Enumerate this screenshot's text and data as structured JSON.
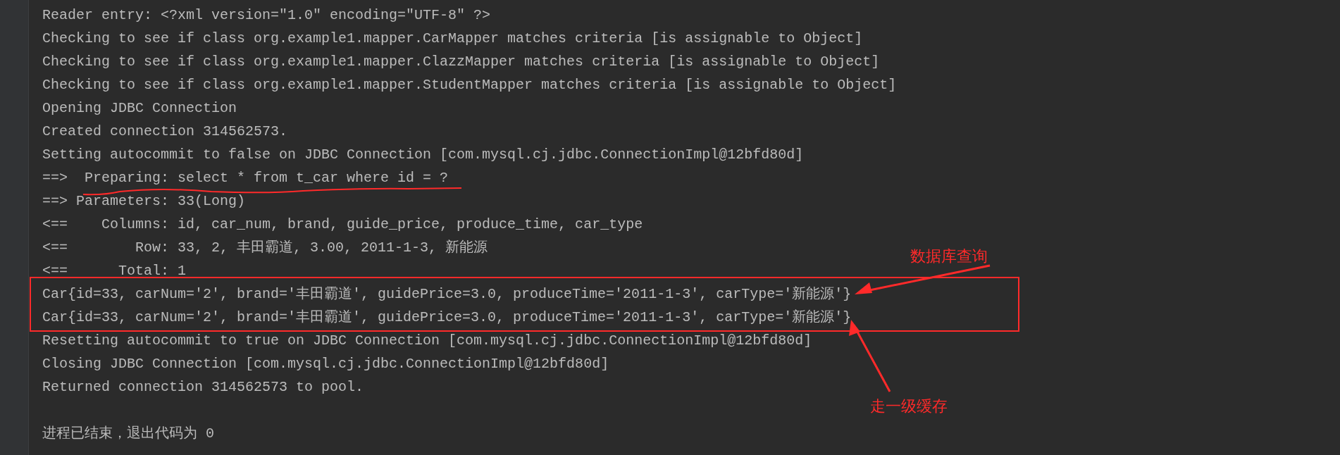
{
  "console": {
    "lines": [
      "Reader entry: <?xml version=\"1.0\" encoding=\"UTF-8\" ?>",
      "Checking to see if class org.example1.mapper.CarMapper matches criteria [is assignable to Object]",
      "Checking to see if class org.example1.mapper.ClazzMapper matches criteria [is assignable to Object]",
      "Checking to see if class org.example1.mapper.StudentMapper matches criteria [is assignable to Object]",
      "Opening JDBC Connection",
      "Created connection 314562573.",
      "Setting autocommit to false on JDBC Connection [com.mysql.cj.jdbc.ConnectionImpl@12bfd80d]",
      "==>  Preparing: select * from t_car where id = ?",
      "==> Parameters: 33(Long)",
      "<==    Columns: id, car_num, brand, guide_price, produce_time, car_type",
      "<==        Row: 33, 2, 丰田霸道, 3.00, 2011-1-3, 新能源",
      "<==      Total: 1",
      "Car{id=33, carNum='2', brand='丰田霸道', guidePrice=3.0, produceTime='2011-1-3', carType='新能源'}",
      "Car{id=33, carNum='2', brand='丰田霸道', guidePrice=3.0, produceTime='2011-1-3', carType='新能源'}",
      "Resetting autocommit to true on JDBC Connection [com.mysql.cj.jdbc.ConnectionImpl@12bfd80d]",
      "Closing JDBC Connection [com.mysql.cj.jdbc.ConnectionImpl@12bfd80d]",
      "Returned connection 314562573 to pool."
    ],
    "exit_message": "进程已结束，退出代码为 0"
  },
  "annotations": [
    {
      "kind": "underline"
    },
    {
      "kind": "box"
    },
    {
      "kind": "callout",
      "text": "数据库查询"
    },
    {
      "kind": "callout",
      "text": "走一级缓存"
    }
  ]
}
